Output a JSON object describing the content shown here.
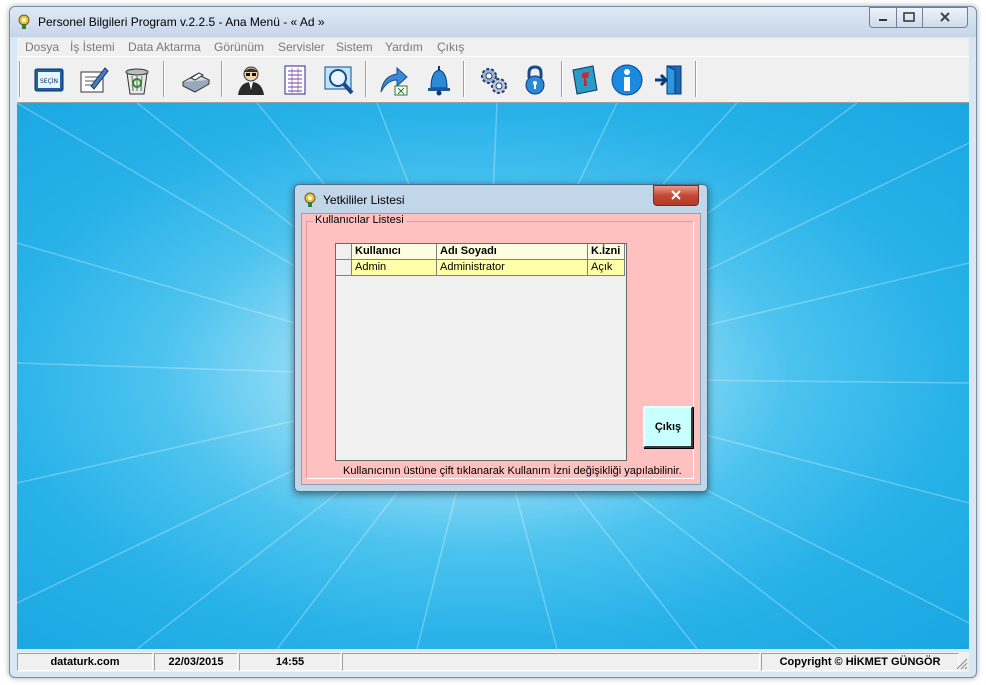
{
  "window": {
    "title": "Personel Bilgileri Program v.2.2.5  - Ana Menü -  « Ad »",
    "icon": "user-q-icon"
  },
  "menu": [
    "Dosya",
    "İş İstemi",
    "Data Aktarma",
    "Görünüm",
    "Servisler",
    "Sistem",
    "Yardım",
    "Çıkış"
  ],
  "toolbar": {
    "buttons": [
      "select-icon",
      "edit-form-icon",
      "recycle-bin-icon",
      "printer-icon",
      "person-icon",
      "document-list-icon",
      "magnifier-icon",
      "export-arrow-icon",
      "bell-icon",
      "settings-gears-icon",
      "lock-icon",
      "book-icon",
      "info-icon",
      "exit-door-icon"
    ]
  },
  "toolbar_sec_label": "SEÇİN",
  "dialog": {
    "title": "Yetkililer Listesi",
    "group_label": "Kullanıcılar Listesi",
    "columns": [
      "Kullanıcı",
      "Adı Soyadı",
      "K.İzni"
    ],
    "rows": [
      {
        "user": "Admin",
        "name": "Administrator",
        "perm": "Açık"
      }
    ],
    "exit_label": "Çıkış",
    "hint": "Kullanıcının üstüne çift tıklanarak Kullanım İzni değişikliği yapılabilinir."
  },
  "status": {
    "site": "dataturk.com",
    "date": "22/03/2015",
    "time": "14:55",
    "copyright": "Copyright © HİKMET GÜNGÖR"
  },
  "colors": {
    "desktop": "#1aa6e2",
    "dialog_body": "#ffc0c0",
    "grid_row": "#ffffa8",
    "exit_button": "#c8ffff"
  }
}
